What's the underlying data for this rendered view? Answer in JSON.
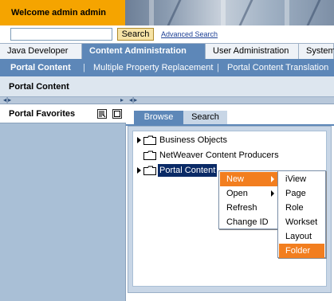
{
  "header": {
    "welcome_text": "Welcome admin admin"
  },
  "search": {
    "value": "",
    "button_label": "Search",
    "advanced_link": "Advanced Search"
  },
  "top_nav": {
    "tabs": [
      {
        "label": "Java Developer"
      },
      {
        "label": "Content Administration"
      },
      {
        "label": "User Administration"
      },
      {
        "label": "System"
      }
    ]
  },
  "sub_nav": {
    "items": [
      {
        "label": "Portal Content"
      },
      {
        "label": "Multiple Property Replacement"
      },
      {
        "label": "Portal Content Translation"
      }
    ],
    "separator": "|"
  },
  "page": {
    "title": "Portal Content"
  },
  "left_panel": {
    "strip_arrows": "◂|▸",
    "title": "Portal Favorites"
  },
  "right_panel": {
    "strip_arrows": "◂|▸",
    "tabs": [
      {
        "label": "Browse"
      },
      {
        "label": "Search"
      }
    ],
    "tree": [
      {
        "label": "Business Objects"
      },
      {
        "label": "NetWeaver Content Producers"
      },
      {
        "label": "Portal Content"
      }
    ]
  },
  "context_menu": {
    "items": [
      {
        "label": "New"
      },
      {
        "label": "Open"
      },
      {
        "label": "Refresh"
      },
      {
        "label": "Change ID"
      }
    ]
  },
  "new_submenu": {
    "items": [
      {
        "label": "iView"
      },
      {
        "label": "Page"
      },
      {
        "label": "Role"
      },
      {
        "label": "Workset"
      },
      {
        "label": "Layout"
      },
      {
        "label": "Folder"
      }
    ]
  },
  "colors": {
    "brand_orange": "#f5a400",
    "nav_blue": "#5d87b8",
    "menu_highlight": "#f27e1f",
    "selection": "#0a2a66"
  }
}
